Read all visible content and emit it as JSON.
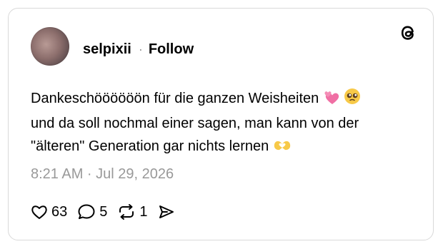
{
  "post": {
    "username": "selpixii",
    "separator": "·",
    "follow_label": "Follow",
    "text_line1": "Dankeschöööööön für die ganzen Weisheiten",
    "text_line2": "und da soll nochmal einer sagen, man kann von der",
    "text_line3": "\"älteren\" Generation gar nichts lernen",
    "timestamp": "8:21 AM · Jul 29, 2026",
    "likes": "63",
    "replies": "5",
    "reposts": "1"
  },
  "icons": {
    "logo": "threads-logo-icon",
    "like": "heart-icon",
    "reply": "speech-bubble-icon",
    "repost": "repost-icon",
    "share": "send-icon",
    "emoji1": "two-hearts-emoji",
    "emoji2": "pleading-face-emoji",
    "emoji3": "heart-hands-emoji"
  },
  "colors": {
    "text": "#000000",
    "muted": "#999999",
    "border": "#d9d9d9",
    "pink": "#f06fa4",
    "emoji_yellow": "#f7c948"
  }
}
